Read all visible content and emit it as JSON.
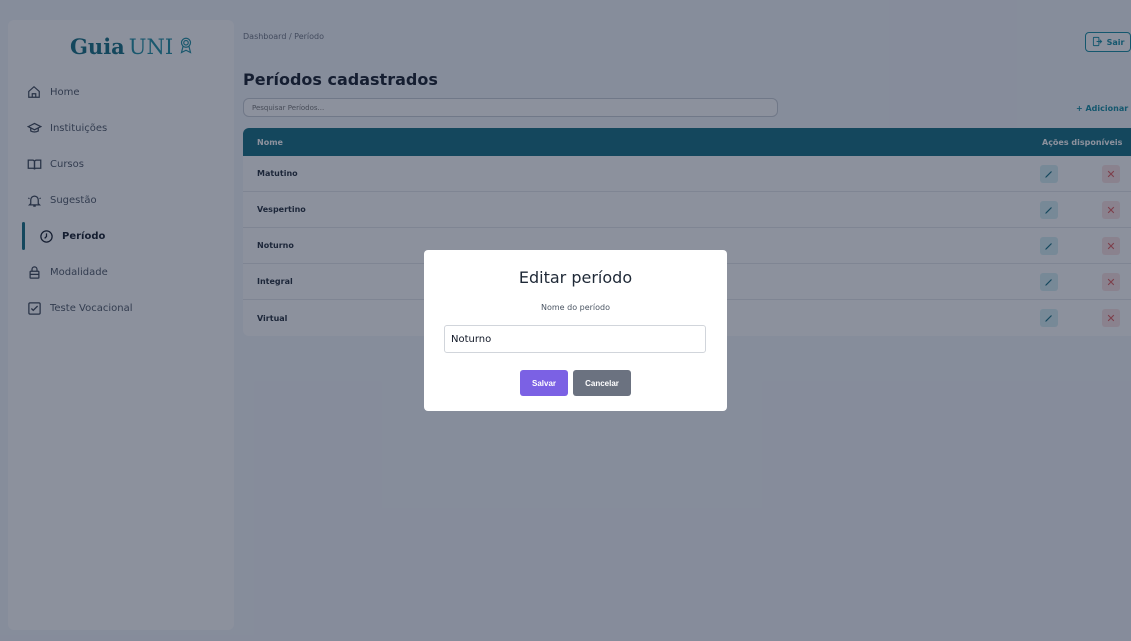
{
  "brand": {
    "name_bold": "Guia",
    "name_light": "UNI"
  },
  "sidebar": {
    "items": [
      {
        "label": "Home",
        "icon": "home-icon"
      },
      {
        "label": "Instituições",
        "icon": "graduation-cap-icon"
      },
      {
        "label": "Cursos",
        "icon": "book-icon"
      },
      {
        "label": "Sugestão",
        "icon": "bell-icon"
      },
      {
        "label": "Período",
        "icon": "clock-icon",
        "active": true
      },
      {
        "label": "Modalidade",
        "icon": "lock-icon"
      },
      {
        "label": "Teste Vocacional",
        "icon": "checkbox-icon"
      }
    ]
  },
  "header": {
    "breadcrumb": "Dashboard / Período",
    "exit_label": "Sair"
  },
  "main": {
    "title": "Períodos cadastrados",
    "search_placeholder": "Pesquisar Períodos...",
    "add_label": "+ Adicionar",
    "table": {
      "columns": [
        "Nome",
        "Ações disponíveis"
      ],
      "rows": [
        "Matutino",
        "Vespertino",
        "Noturno",
        "Integral",
        "Virtual"
      ]
    }
  },
  "modal": {
    "title": "Editar período",
    "field_label": "Nome do período",
    "field_value": "Noturno",
    "save_label": "Salvar",
    "cancel_label": "Cancelar"
  },
  "colors": {
    "accent": "#0f6b7e",
    "save": "#7b61e4",
    "cancel": "#6b7280",
    "overlay": "rgba(25,35,60,0.5)"
  }
}
